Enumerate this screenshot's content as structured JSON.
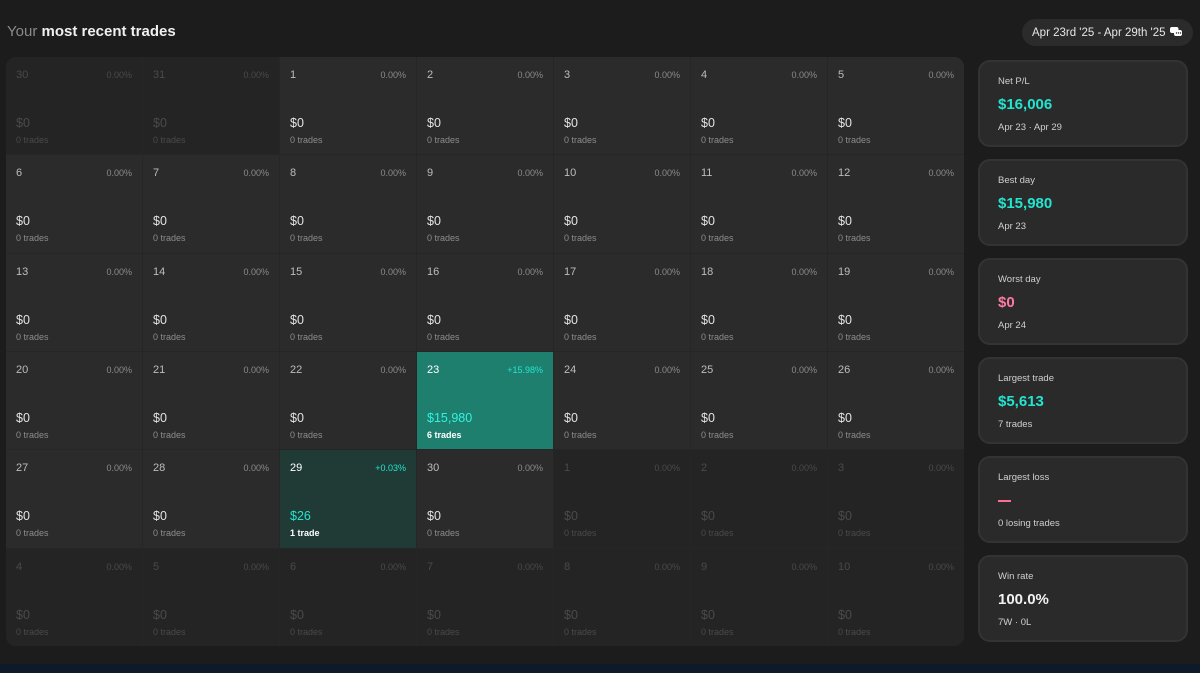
{
  "header": {
    "title_prefix": "Your",
    "title_main": "most recent trades",
    "date_range": "Apr 23rd '25 - Apr 29th '25",
    "date_icon": "calendar-chat-icon"
  },
  "calendar": [
    {
      "num": "30",
      "pct": "0.00%",
      "amount": "$0",
      "trades": "0 trades",
      "state": "muted"
    },
    {
      "num": "31",
      "pct": "0.00%",
      "amount": "$0",
      "trades": "0 trades",
      "state": "muted"
    },
    {
      "num": "1",
      "pct": "0.00%",
      "amount": "$0",
      "trades": "0 trades",
      "state": "normal"
    },
    {
      "num": "2",
      "pct": "0.00%",
      "amount": "$0",
      "trades": "0 trades",
      "state": "normal"
    },
    {
      "num": "3",
      "pct": "0.00%",
      "amount": "$0",
      "trades": "0 trades",
      "state": "normal"
    },
    {
      "num": "4",
      "pct": "0.00%",
      "amount": "$0",
      "trades": "0 trades",
      "state": "normal"
    },
    {
      "num": "5",
      "pct": "0.00%",
      "amount": "$0",
      "trades": "0 trades",
      "state": "normal"
    },
    {
      "num": "6",
      "pct": "0.00%",
      "amount": "$0",
      "trades": "0 trades",
      "state": "normal"
    },
    {
      "num": "7",
      "pct": "0.00%",
      "amount": "$0",
      "trades": "0 trades",
      "state": "normal"
    },
    {
      "num": "8",
      "pct": "0.00%",
      "amount": "$0",
      "trades": "0 trades",
      "state": "normal"
    },
    {
      "num": "9",
      "pct": "0.00%",
      "amount": "$0",
      "trades": "0 trades",
      "state": "normal"
    },
    {
      "num": "10",
      "pct": "0.00%",
      "amount": "$0",
      "trades": "0 trades",
      "state": "normal"
    },
    {
      "num": "11",
      "pct": "0.00%",
      "amount": "$0",
      "trades": "0 trades",
      "state": "normal"
    },
    {
      "num": "12",
      "pct": "0.00%",
      "amount": "$0",
      "trades": "0 trades",
      "state": "normal"
    },
    {
      "num": "13",
      "pct": "0.00%",
      "amount": "$0",
      "trades": "0 trades",
      "state": "normal"
    },
    {
      "num": "14",
      "pct": "0.00%",
      "amount": "$0",
      "trades": "0 trades",
      "state": "normal"
    },
    {
      "num": "15",
      "pct": "0.00%",
      "amount": "$0",
      "trades": "0 trades",
      "state": "normal"
    },
    {
      "num": "16",
      "pct": "0.00%",
      "amount": "$0",
      "trades": "0 trades",
      "state": "normal"
    },
    {
      "num": "17",
      "pct": "0.00%",
      "amount": "$0",
      "trades": "0 trades",
      "state": "normal"
    },
    {
      "num": "18",
      "pct": "0.00%",
      "amount": "$0",
      "trades": "0 trades",
      "state": "normal"
    },
    {
      "num": "19",
      "pct": "0.00%",
      "amount": "$0",
      "trades": "0 trades",
      "state": "normal"
    },
    {
      "num": "20",
      "pct": "0.00%",
      "amount": "$0",
      "trades": "0 trades",
      "state": "normal"
    },
    {
      "num": "21",
      "pct": "0.00%",
      "amount": "$0",
      "trades": "0 trades",
      "state": "normal"
    },
    {
      "num": "22",
      "pct": "0.00%",
      "amount": "$0",
      "trades": "0 trades",
      "state": "normal"
    },
    {
      "num": "23",
      "pct": "+15.98%",
      "amount": "$15,980",
      "trades": "6 trades",
      "state": "win-strong"
    },
    {
      "num": "24",
      "pct": "0.00%",
      "amount": "$0",
      "trades": "0 trades",
      "state": "normal"
    },
    {
      "num": "25",
      "pct": "0.00%",
      "amount": "$0",
      "trades": "0 trades",
      "state": "normal"
    },
    {
      "num": "26",
      "pct": "0.00%",
      "amount": "$0",
      "trades": "0 trades",
      "state": "normal"
    },
    {
      "num": "27",
      "pct": "0.00%",
      "amount": "$0",
      "trades": "0 trades",
      "state": "normal"
    },
    {
      "num": "28",
      "pct": "0.00%",
      "amount": "$0",
      "trades": "0 trades",
      "state": "normal"
    },
    {
      "num": "29",
      "pct": "+0.03%",
      "amount": "$26",
      "trades": "1 trade",
      "state": "win-light"
    },
    {
      "num": "30",
      "pct": "0.00%",
      "amount": "$0",
      "trades": "0 trades",
      "state": "normal"
    },
    {
      "num": "1",
      "pct": "0.00%",
      "amount": "$0",
      "trades": "0 trades",
      "state": "muted"
    },
    {
      "num": "2",
      "pct": "0.00%",
      "amount": "$0",
      "trades": "0 trades",
      "state": "muted"
    },
    {
      "num": "3",
      "pct": "0.00%",
      "amount": "$0",
      "trades": "0 trades",
      "state": "muted"
    },
    {
      "num": "4",
      "pct": "0.00%",
      "amount": "$0",
      "trades": "0 trades",
      "state": "muted"
    },
    {
      "num": "5",
      "pct": "0.00%",
      "amount": "$0",
      "trades": "0 trades",
      "state": "muted"
    },
    {
      "num": "6",
      "pct": "0.00%",
      "amount": "$0",
      "trades": "0 trades",
      "state": "muted"
    },
    {
      "num": "7",
      "pct": "0.00%",
      "amount": "$0",
      "trades": "0 trades",
      "state": "muted"
    },
    {
      "num": "8",
      "pct": "0.00%",
      "amount": "$0",
      "trades": "0 trades",
      "state": "muted"
    },
    {
      "num": "9",
      "pct": "0.00%",
      "amount": "$0",
      "trades": "0 trades",
      "state": "muted"
    },
    {
      "num": "10",
      "pct": "0.00%",
      "amount": "$0",
      "trades": "0 trades",
      "state": "muted"
    }
  ],
  "stats": [
    {
      "label": "Net P/L",
      "value": "$16,006",
      "sub": "Apr 23 · Apr 29",
      "tone": "teal"
    },
    {
      "label": "Best day",
      "value": "$15,980",
      "sub": "Apr 23",
      "tone": "teal"
    },
    {
      "label": "Worst day",
      "value": "$0",
      "sub": "Apr 24",
      "tone": "pink"
    },
    {
      "label": "Largest trade",
      "value": "$5,613",
      "sub": "7 trades",
      "tone": "teal"
    },
    {
      "label": "Largest loss",
      "value": "",
      "sub": "0 losing trades",
      "tone": "dash"
    },
    {
      "label": "Win rate",
      "value": "100.0%",
      "sub": "7W · 0L",
      "tone": "white"
    }
  ],
  "colors": {
    "accent_teal": "#22e5cf",
    "accent_pink": "#ff7aa2",
    "win_strong_bg": "#1f7f6f",
    "win_light_bg": "#203b35"
  }
}
